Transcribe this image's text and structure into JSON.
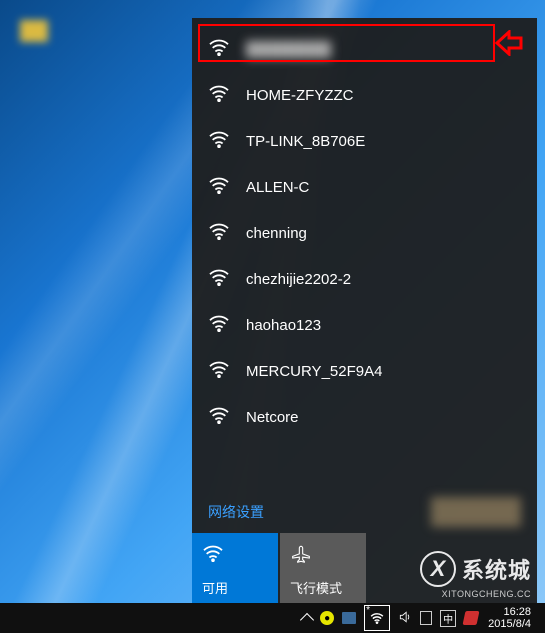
{
  "desktop": {
    "icon_label": ""
  },
  "panel": {
    "networks": [
      {
        "name": ""
      },
      {
        "name": "HOME-ZFYZZC"
      },
      {
        "name": "TP-LINK_8B706E"
      },
      {
        "name": "ALLEN-C"
      },
      {
        "name": "chenning"
      },
      {
        "name": "chezhijie2202-2"
      },
      {
        "name": "haohao123"
      },
      {
        "name": "MERCURY_52F9A4"
      },
      {
        "name": "Netcore"
      }
    ],
    "settings_link": "网络设置",
    "tiles": {
      "wifi": {
        "label": "可用",
        "state": "on"
      },
      "airplane": {
        "label": "飞行模式",
        "state": "off"
      }
    }
  },
  "taskbar": {
    "ime_label": "中",
    "clock_time": "16:28",
    "clock_date": "2015/8/4"
  },
  "watermark": {
    "brand": "系统城",
    "url": "XITONGCHENG.CC"
  }
}
